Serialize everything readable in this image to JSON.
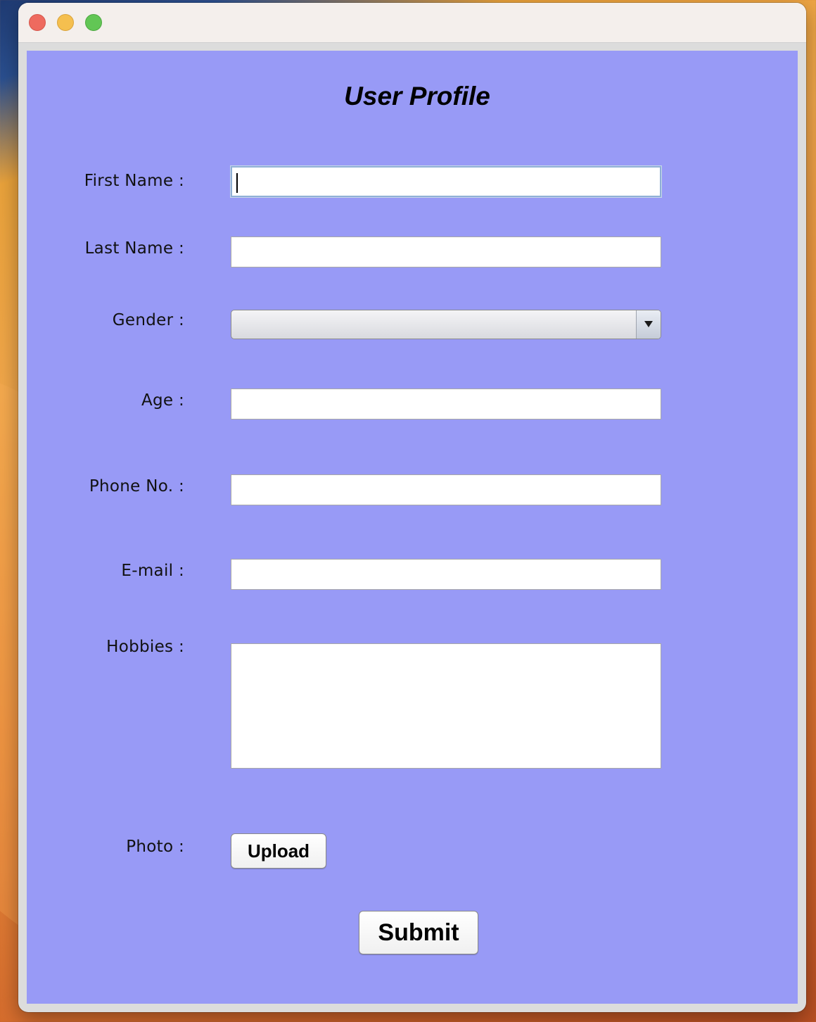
{
  "form": {
    "title": "User Profile",
    "first_name": {
      "label": "First Name :",
      "value": ""
    },
    "last_name": {
      "label": "Last Name :",
      "value": ""
    },
    "gender": {
      "label": "Gender :",
      "selected": ""
    },
    "age": {
      "label": "Age :",
      "value": ""
    },
    "phone": {
      "label": "Phone No. :",
      "value": ""
    },
    "email": {
      "label": "E-mail :",
      "value": ""
    },
    "hobbies": {
      "label": "Hobbies :",
      "value": ""
    },
    "photo": {
      "label": "Photo :",
      "upload_label": "Upload"
    },
    "submit_label": "Submit"
  },
  "colors": {
    "form_background": "#989af6",
    "titlebar": "#f4efec"
  },
  "window_controls": [
    "close-button",
    "minimize-button",
    "zoom-button"
  ]
}
